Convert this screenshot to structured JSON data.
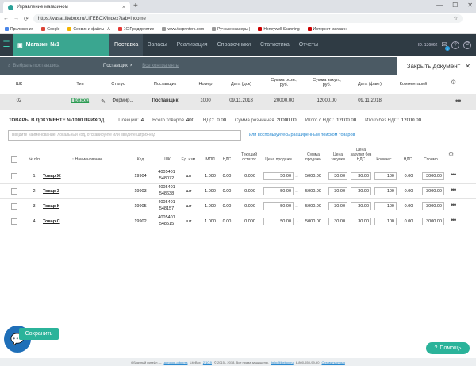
{
  "browser": {
    "tab_title": "Управление магазином",
    "url": "https://vasat.litebox.ru/LITEBOX/index?tab=income",
    "bookmarks": [
      {
        "label": "Приложения",
        "color": "#4a86e8"
      },
      {
        "label": "Google",
        "color": "#db4437"
      },
      {
        "label": "Сервис и файлы | А",
        "color": "#f4b400"
      },
      {
        "label": "1С:Предприятие",
        "color": "#e53935"
      },
      {
        "label": "www.tscprinters.com",
        "color": "#999999"
      },
      {
        "label": "Ручные сканеры |",
        "color": "#999999"
      },
      {
        "label": "Honeywell Scanning",
        "color": "#cc0000"
      },
      {
        "label": "Интернет-магазин",
        "color": "#cc0000"
      }
    ]
  },
  "app": {
    "store_label": "Магазин №1",
    "nav": [
      "Поставка",
      "Запасы",
      "Реализация",
      "Справочники",
      "Статистика",
      "Отчеты"
    ],
    "user_id": "ID: 136062",
    "mail_count": "1",
    "accent": "#3aa690"
  },
  "subbar": {
    "supplier_placeholder": "Выбрать поставщика",
    "tag": "Поставщик",
    "all_contractors": "Все контрагенты",
    "close_doc": "Закрыть документ"
  },
  "doc_header": [
    "ШК",
    "Тип",
    "Статус",
    "Поставщик",
    "Номер",
    "Дата (док)",
    "Сумма розн., руб.",
    "Сумма закуп., руб.",
    "Дата (факт)",
    "Комментарий"
  ],
  "doc_row": {
    "shk": "02",
    "type": "Приход",
    "status": "Формир...",
    "supplier": "Поставщик",
    "number": "1000",
    "date_doc": "09.11.2018",
    "sum_retail": "20000.00",
    "sum_purchase": "12000.00",
    "date_fact": "09.11.2018",
    "comment": ""
  },
  "summary": {
    "title": "ТОВАРЫ В ДОКУМЕНТЕ №1000 ПРИХОД",
    "positions_label": "Позиций:",
    "positions": "4",
    "total_label": "Всего товаров",
    "total": "400",
    "vat_label": "НДС:",
    "vat": "0.00",
    "retail_label": "Сумма розничная",
    "retail": "20000.00",
    "with_vat_label": "Итого с НДС:",
    "with_vat": "12000.00",
    "without_vat_label": "Итого без НДС:",
    "without_vat": "12000.00"
  },
  "search": {
    "placeholder": "Введите наименование, локальный код, отсканируйте или введите штрих-код",
    "advanced": "или воспользуйтесь расширенным поиском товаров"
  },
  "table": {
    "headers": {
      "num": "№ п/п",
      "name": "Наименование",
      "code": "Код",
      "shk": "ШК",
      "unit": "Ед. изм.",
      "mpp": "МПП",
      "vat": "НДС",
      "stock": "Текущий остаток",
      "price_sale": "Цена продажи",
      "sum_sale": "Сумма продажи",
      "price_purchase": "Цена закупки",
      "price_purchase_novat": "Цена закупки без НДС",
      "qty": "Количес...",
      "vat2": "НДС",
      "cost": "Стоимо..."
    },
    "rows": [
      {
        "num": "1",
        "name": "Товар Ж",
        "code": "19904",
        "shk1": "4005401",
        "shk2": "548072",
        "unit": "шт",
        "mpp": "1.000",
        "vat": "0.00",
        "stock": "0.000",
        "price_sale": "50.00",
        "sum_sale": "5000.00",
        "price_purchase": "30.00",
        "price_purchase_novat": "30.00",
        "qty": "100",
        "vat2": "0.00",
        "cost": "3000.00"
      },
      {
        "num": "2",
        "name": "Товар З",
        "code": "19903",
        "shk1": "4005401",
        "shk2": "548638",
        "unit": "шт",
        "mpp": "1.000",
        "vat": "0.00",
        "stock": "0.000",
        "price_sale": "50.00",
        "sum_sale": "5000.00",
        "price_purchase": "30.00",
        "price_purchase_novat": "30.00",
        "qty": "100",
        "vat2": "0.00",
        "cost": "3000.00"
      },
      {
        "num": "3",
        "name": "Товар К",
        "code": "19905",
        "shk1": "4005401",
        "shk2": "548157",
        "unit": "шт",
        "mpp": "1.000",
        "vat": "0.00",
        "stock": "0.000",
        "price_sale": "50.00",
        "sum_sale": "5000.00",
        "price_purchase": "30.00",
        "price_purchase_novat": "30.00",
        "qty": "100",
        "vat2": "0.00",
        "cost": "3000.00"
      },
      {
        "num": "4",
        "name": "Товар С",
        "code": "19902",
        "shk1": "4005401",
        "shk2": "548515",
        "unit": "шт",
        "mpp": "1.000",
        "vat": "0.00",
        "stock": "0.000",
        "price_sale": "50.00",
        "sum_sale": "5000.00",
        "price_purchase": "30.00",
        "price_purchase_novat": "30.00",
        "qty": "100",
        "vat2": "0.00",
        "cost": "3000.00"
      }
    ]
  },
  "buttons": {
    "save": "Сохранить",
    "help": "Помощь"
  },
  "footer": {
    "text1": "Облачный ритейл —",
    "offer": "договор-оферта",
    "text2": "LiteBox",
    "version": "2.10.9",
    "text3": "© 2015 - 2018. Все права защищены.",
    "email": "help@litebox.ru",
    "phone": "8-800-550-99-60",
    "feedback": "Оставить отзыв"
  }
}
